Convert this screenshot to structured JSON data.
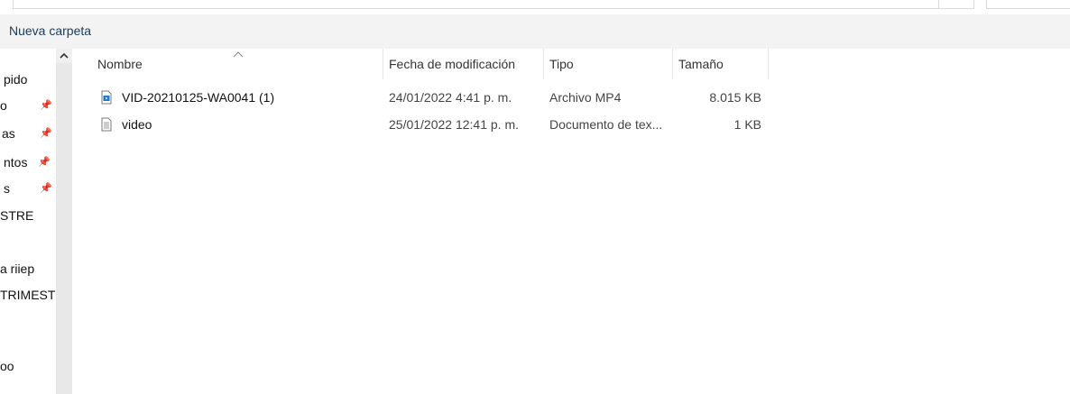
{
  "command_bar": {
    "new_folder_label": "Nueva carpeta"
  },
  "nav": {
    "items": [
      {
        "label": "pido",
        "pinned": false
      },
      {
        "label": "o",
        "pinned": true
      },
      {
        "label": "as",
        "pinned": true
      },
      {
        "label": "ntos",
        "pinned": true
      },
      {
        "label": "s",
        "pinned": true
      },
      {
        "label": "STRE",
        "pinned": false
      },
      {
        "label": "a riiep",
        "pinned": false
      },
      {
        "label": "TRIMEST",
        "pinned": false
      },
      {
        "label": "oo",
        "pinned": false
      }
    ]
  },
  "columns": {
    "name": "Nombre",
    "date": "Fecha de modificación",
    "type": "Tipo",
    "size": "Tamaño"
  },
  "files": [
    {
      "name": "VID-20210125-WA0041 (1)",
      "date": "24/01/2022 4:41 p. m.",
      "type": "Archivo MP4",
      "size": "8.015 KB",
      "icon": "video-file-icon"
    },
    {
      "name": "video",
      "date": "25/01/2022 12:41 p. m.",
      "type": "Documento de tex...",
      "size": "1 KB",
      "icon": "text-file-icon"
    }
  ],
  "colors": {
    "command_bar_bg": "#f3f3f3",
    "scrollbar_bg": "#e8e8e8",
    "accent": "#1e78c8"
  }
}
